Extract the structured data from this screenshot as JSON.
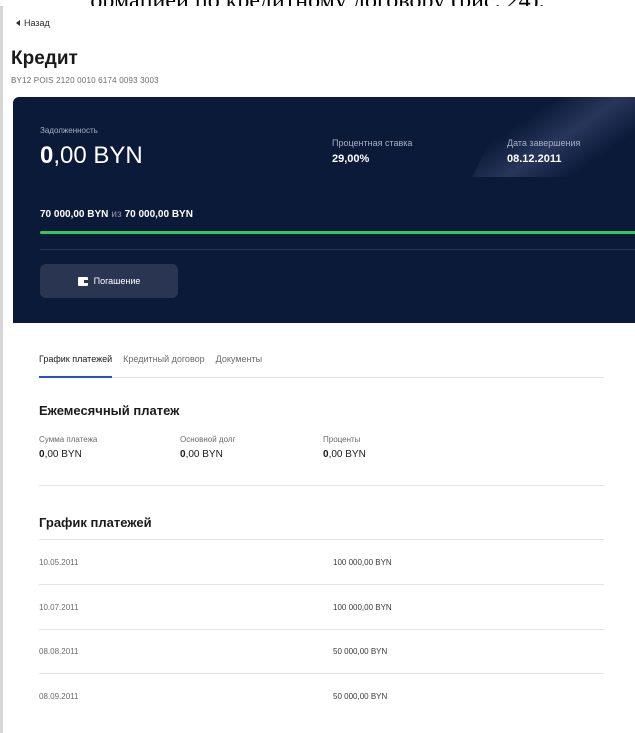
{
  "doc_caption": "ормацией по кредитному договору (рис. 24).",
  "back_label": "Назад",
  "page_title": "Кредит",
  "account_number": "BY12 POIS 2120 0010 6174 0093 3003",
  "card": {
    "debt_label": "Задолженность",
    "debt_amount_bold": "0",
    "debt_amount_rest": ",00 BYN",
    "rate_label": "Процентная ставка",
    "rate_value": "29,00%",
    "end_label": "Дата завершения",
    "end_value": "08.12.2011",
    "paid_amount": "70 000,00 BYN",
    "of_word": "из",
    "total_amount": "70 000,00 BYN",
    "progress_percent": 100,
    "repay_button": "Погашение"
  },
  "tabs": [
    "График платежей",
    "Кредитный договор",
    "Документы"
  ],
  "monthly": {
    "title": "Ежемесячный платеж",
    "items": [
      {
        "label": "Сумма платежа",
        "bold": "0",
        "rest": ",00 BYN"
      },
      {
        "label": "Основной долг",
        "bold": "0",
        "rest": ",00 BYN"
      },
      {
        "label": "Проценты",
        "bold": "0",
        "rest": ",00 BYN"
      }
    ]
  },
  "schedule": {
    "title": "График платежей",
    "rows": [
      {
        "date": "10.05.2011",
        "amount": "100 000,00 BYN"
      },
      {
        "date": "10.07.2011",
        "amount": "100 000,00 BYN"
      },
      {
        "date": "08.08.2011",
        "amount": "50 000,00 BYN"
      },
      {
        "date": "08.09.2011",
        "amount": "50 000,00 BYN"
      }
    ]
  }
}
